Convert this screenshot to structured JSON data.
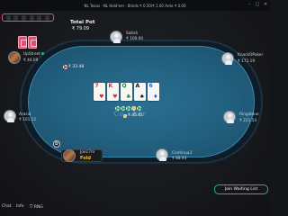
{
  "window": {
    "title": "NL Texas · NL Hold'em · Blinds ₹ 0.50/₹ 1.00 Ante ₹ 0.00",
    "icons": [
      "minimize-icon",
      "maximize-icon",
      "close-icon"
    ]
  },
  "hand_widget": {
    "color": "#e0517b"
  },
  "pot": {
    "label": "Total Pot",
    "value": "₹ 79.09",
    "center_amount": "₹ 45.61"
  },
  "bet": {
    "amount": "₹ 33.48"
  },
  "board": {
    "cards": [
      {
        "rank": "7",
        "suit": "♥",
        "color": "red"
      },
      {
        "rank": "K",
        "suit": "♥",
        "color": "red"
      },
      {
        "rank": "Q",
        "suit": "♣",
        "color": "grn"
      },
      {
        "rank": "A",
        "suit": "♠",
        "color": "blk"
      },
      {
        "rank": "6",
        "suit": "♦",
        "color": "blu"
      }
    ]
  },
  "table": {
    "logo": "Co...ker"
  },
  "players": {
    "top_left": {
      "name": "UpStreet",
      "stack": "₹ 44.09"
    },
    "top": {
      "name": "Satish",
      "stack": "₹ 100.00"
    },
    "right_top": {
      "name": "KnackOPoker",
      "stack": "₹ 172.19"
    },
    "left": {
      "name": "Arasia",
      "stack": "₹ 101.12"
    },
    "right": {
      "name": "Ringablue",
      "stack": "₹ 221.54"
    },
    "bottom": {
      "name": "Continuu3",
      "stack": "₹ 88.93"
    },
    "hero": {
      "name": "Joe17m",
      "action": "Fold"
    }
  },
  "dealer_button": "D",
  "actions": {
    "join_waiting_list": "Join Waiting List"
  },
  "bottom_bar": {
    "chat": "Chat",
    "info": "Info",
    "rng": "RNG"
  }
}
